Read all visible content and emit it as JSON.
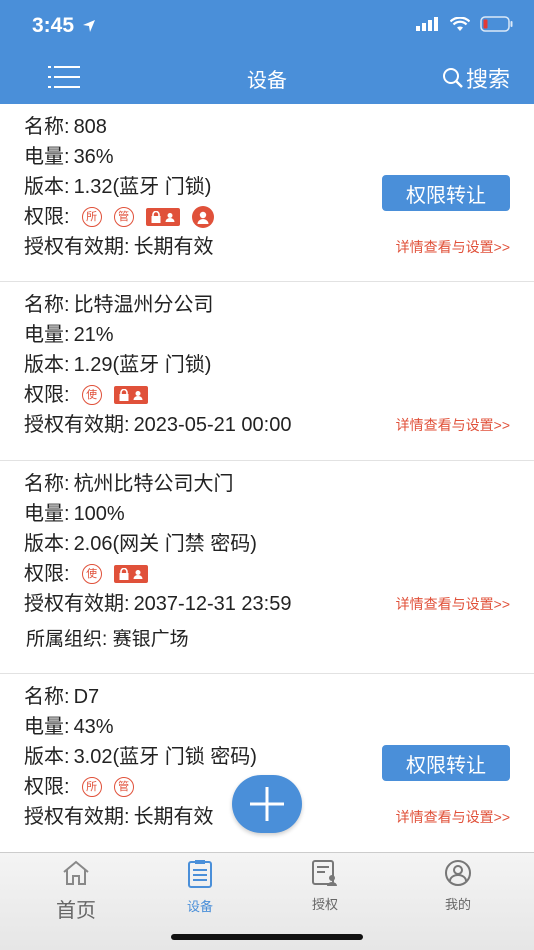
{
  "status_bar": {
    "time": "3:45"
  },
  "nav": {
    "title": "设备",
    "search_label": "搜索"
  },
  "labels": {
    "name": "名称:",
    "battery": "电量:",
    "version": "版本:",
    "permission": "权限:",
    "validity": "授权有效期:",
    "org": "所属组织:",
    "transfer": "权限转让",
    "detail": "详情查看与设置>>"
  },
  "devices": [
    {
      "name": "808",
      "battery": "36%",
      "version": "1.32(蓝牙 门锁)",
      "validity": "长期有效",
      "permissions": [
        "所",
        "管",
        "lock",
        "person"
      ],
      "has_transfer": true
    },
    {
      "name": "比特温州分公司",
      "battery": "21%",
      "version": "1.29(蓝牙 门锁)",
      "validity": "2023-05-21 00:00",
      "permissions": [
        "使",
        "lock"
      ],
      "has_transfer": false
    },
    {
      "name": "杭州比特公司大门",
      "battery": "100%",
      "version": "2.06(网关 门禁 密码)",
      "validity": "2037-12-31 23:59",
      "permissions": [
        "使",
        "lock"
      ],
      "has_transfer": false,
      "org": "赛银广场"
    },
    {
      "name": "D7",
      "battery": "43%",
      "version": "3.02(蓝牙 门锁 密码)",
      "validity": "长期有效",
      "permissions": [
        "所",
        "管"
      ],
      "has_transfer": true
    }
  ],
  "tabs": [
    {
      "label": "首页",
      "icon": "home-icon",
      "active": false
    },
    {
      "label": "设备",
      "icon": "device-icon",
      "active": true
    },
    {
      "label": "授权",
      "icon": "authorize-icon",
      "active": false
    },
    {
      "label": "我的",
      "icon": "profile-icon",
      "active": false
    }
  ],
  "colors": {
    "primary": "#4a8fd9",
    "accent_red": "#e0513a"
  }
}
